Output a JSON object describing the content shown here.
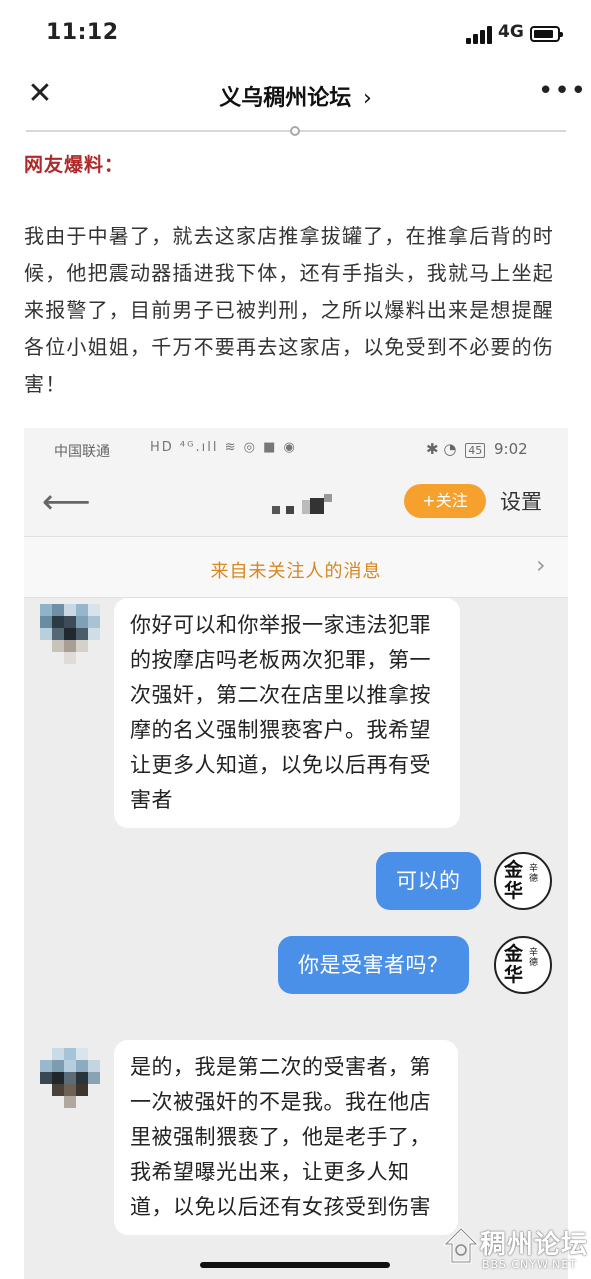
{
  "status_bar": {
    "time": "11:12",
    "network": "4G"
  },
  "title_bar": {
    "title": "义乌稠州论坛",
    "chevron": "›",
    "close_icon": "close-icon",
    "more_icon": "more-icon"
  },
  "article": {
    "label": "网友爆料：",
    "label_color": "#b0282a",
    "body": "我由于中暑了，就去这家店推拿拔罐了，在推拿后背的时候，他把震动器插进我下体，还有手指头，我就马上坐起来报警了，目前男子已被判刑，之所以爆料出来是想提醒各位小姐姐，千万不要再去这家店，以免受到不必要的伤害！"
  },
  "screenshot": {
    "status": {
      "carrier": "中国联通",
      "icons": "HD ⁴ᴳ.ıll ≋ ◎ ■ ◉",
      "right_icons": "✱ ◔",
      "battery": "45",
      "time": "9:02"
    },
    "header": {
      "back_icon": "back-arrow-icon",
      "follow_label": "+关注",
      "settings_label": "设置",
      "accent": "#f6a12d"
    },
    "banner": {
      "text": "来自未关注人的消息",
      "chevron": "›"
    },
    "messages": [
      {
        "side": "left",
        "text": "你好可以和你举报一家违法犯罪的按摩店吗老板两次犯罪，第一次强奸，第二次在店里以推拿按摩的名义强制猥亵客户。我希望让更多人知道，以免以后再有受害者"
      },
      {
        "side": "right",
        "text": "可以的"
      },
      {
        "side": "right",
        "text": "你是受害者吗？"
      },
      {
        "side": "left",
        "text": "是的，我是第二次的受害者，第一次被强奸的不是我。我在他店里被强制猥亵了，他是老手了，我希望曝光出来，让更多人知道，以免以后还有女孩受到伤害"
      }
    ],
    "logo_avatar": {
      "big": "金华",
      "small": "辛德"
    },
    "bubble_right_color": "#4a8fe8"
  },
  "watermark": {
    "title": "稠州论坛",
    "url": "BBS.CNYW.NET"
  }
}
